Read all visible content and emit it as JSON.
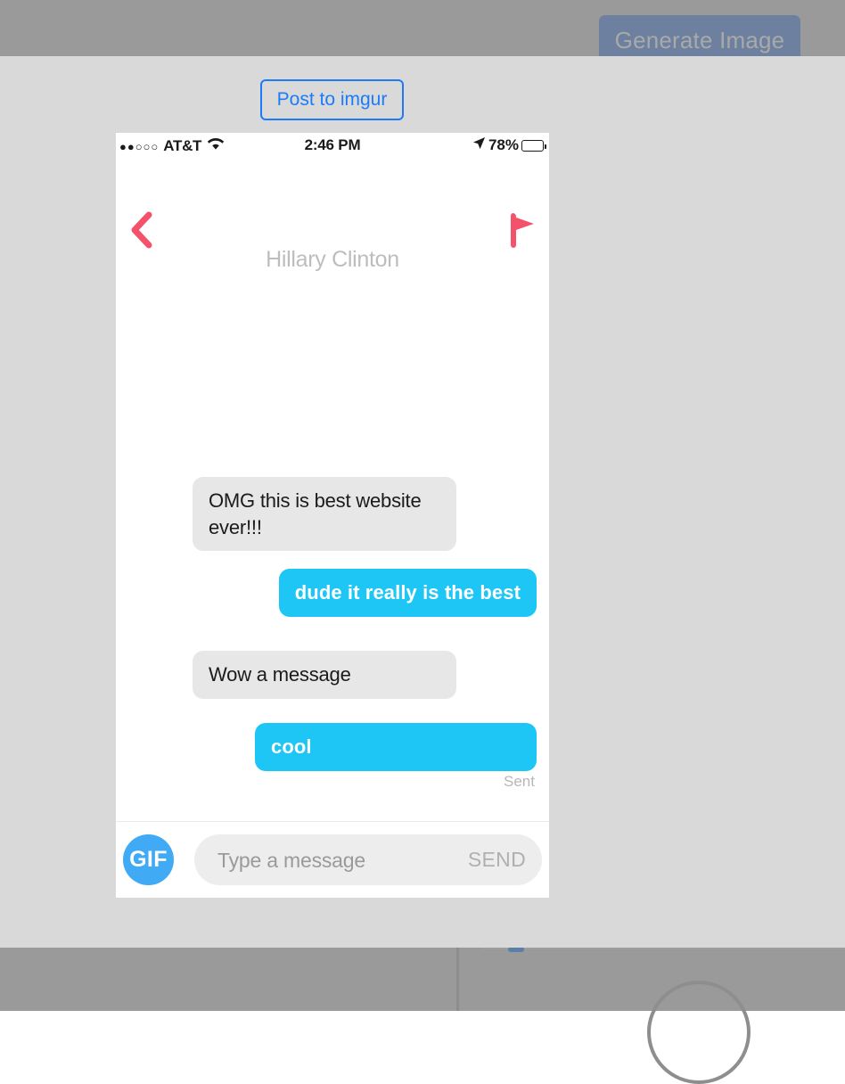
{
  "background": {
    "generate_button_label": "Generate Image",
    "generate_button_color": "#6d80a0",
    "overlay_color": "#9a9a9a"
  },
  "modal": {
    "background_color": "#d9d9d9",
    "imgur_button_label": "Post to imgur",
    "imgur_button_accent": "#1a7cfa"
  },
  "phone": {
    "status_bar": {
      "signal_dots": "●●○○○",
      "carrier": "AT&T",
      "wifi_icon": "wifi-icon",
      "time": "2:46 PM",
      "location_icon": "location-arrow-icon",
      "battery_percent": "78%",
      "battery_level": 78
    },
    "header": {
      "back_icon": "back-chevron-icon",
      "flag_icon": "flag-icon",
      "accent_color": "#f4516a",
      "contact_name": "Hillary Clinton",
      "avatar": "contact-avatar"
    },
    "conversation": {
      "messages": [
        {
          "id": "msg-1",
          "direction": "incoming",
          "text": "OMG this is best website ever!!!",
          "has_avatar": true
        },
        {
          "id": "msg-2",
          "direction": "outgoing",
          "text": "dude it really is the best",
          "has_avatar": false
        },
        {
          "id": "msg-3",
          "direction": "incoming",
          "text": "Wow a message",
          "has_avatar": true,
          "has_like": true,
          "like_icon": "heart-outline-icon"
        },
        {
          "id": "msg-4",
          "direction": "outgoing",
          "text": "cool",
          "has_avatar": false,
          "status": "Sent"
        }
      ],
      "incoming_bubble_color": "#e7e7e7",
      "outgoing_bubble_color": "#1ec6f5",
      "status_text": "Sent"
    },
    "composer": {
      "gif_label": "GIF",
      "gif_color": "#41aaf5",
      "input_value": "",
      "input_placeholder": "Type a message",
      "send_label": "SEND"
    }
  }
}
